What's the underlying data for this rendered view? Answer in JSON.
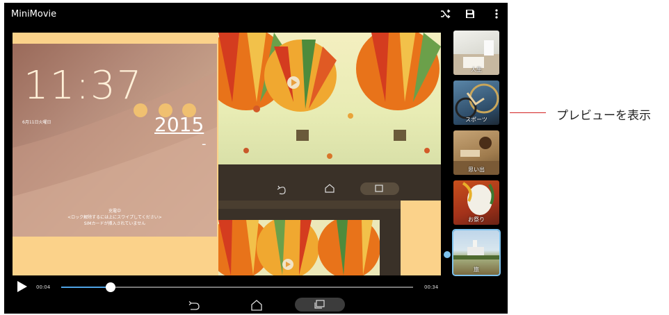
{
  "app": {
    "title": "MiniMovie"
  },
  "toolbar": {
    "shuffle_icon": "shuffle-icon",
    "save_icon": "save-icon",
    "menu_icon": "more-vert-icon"
  },
  "lockscreen": {
    "time": "11:37",
    "date": "6月11日火曜日",
    "year": "2015",
    "dash": "-",
    "charging": "充電中",
    "unlock_hint": "<ロック解除するには上にスワイプしてください>",
    "sim_notice": "SIMカードが挿入されていません"
  },
  "player": {
    "current": "00:04",
    "duration": "00:34",
    "progress": 0.14
  },
  "themes": [
    {
      "label": "人生"
    },
    {
      "label": "スポーツ"
    },
    {
      "label": "思い出"
    },
    {
      "label": "お祭り"
    },
    {
      "label": "旅",
      "selected": true
    }
  ],
  "callout": "プレビューを表示",
  "colors": {
    "accent": "#4ea4e6",
    "selection": "#7ec3ee",
    "callout_line": "#d32020"
  }
}
